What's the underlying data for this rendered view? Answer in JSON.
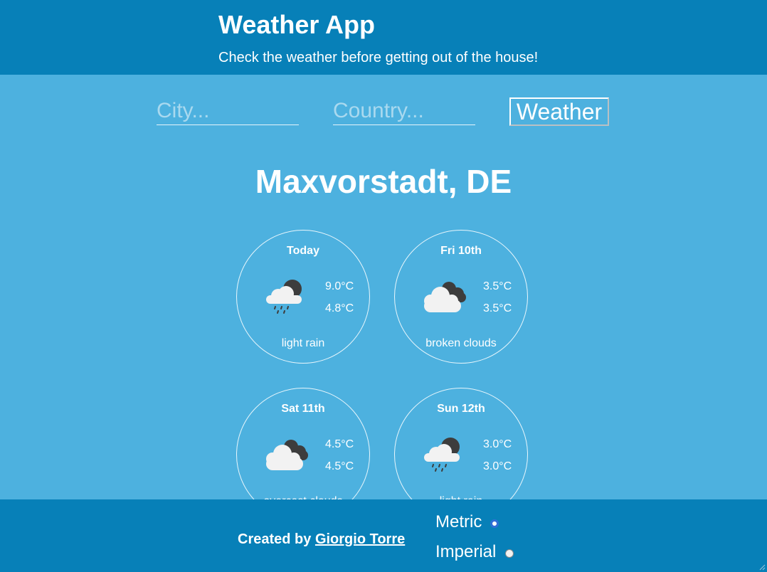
{
  "header": {
    "title": "Weather App",
    "subtitle": "Check the weather before getting out of the house!"
  },
  "search": {
    "city_placeholder": "City...",
    "country_placeholder": "Country...",
    "button_label": "Weather"
  },
  "location": "Maxvorstadt, DE",
  "forecast": [
    {
      "day": "Today",
      "max": "9.0°C",
      "min": "4.8°C",
      "description": "light rain",
      "icon": "cloud-rain-icon"
    },
    {
      "day": "Fri 10th",
      "max": "3.5°C",
      "min": "3.5°C",
      "description": "broken clouds",
      "icon": "broken-clouds-icon"
    },
    {
      "day": "Sat 11th",
      "max": "4.5°C",
      "min": "4.5°C",
      "description": "overcast clouds",
      "icon": "overcast-clouds-icon"
    },
    {
      "day": "Sun 12th",
      "max": "3.0°C",
      "min": "3.0°C",
      "description": "light rain",
      "icon": "cloud-rain-icon"
    }
  ],
  "footer": {
    "credit_prefix": "Created by",
    "author": "Giorgio Torre",
    "units": [
      {
        "label": "Metric",
        "selected": true
      },
      {
        "label": "Imperial",
        "selected": false
      }
    ]
  },
  "colors": {
    "page_background": "#4db1df",
    "header_footer_background": "#0780b8",
    "text": "#ffffff",
    "dark_cloud": "#3d3d3d",
    "light_cloud": "#f2f2f2"
  }
}
